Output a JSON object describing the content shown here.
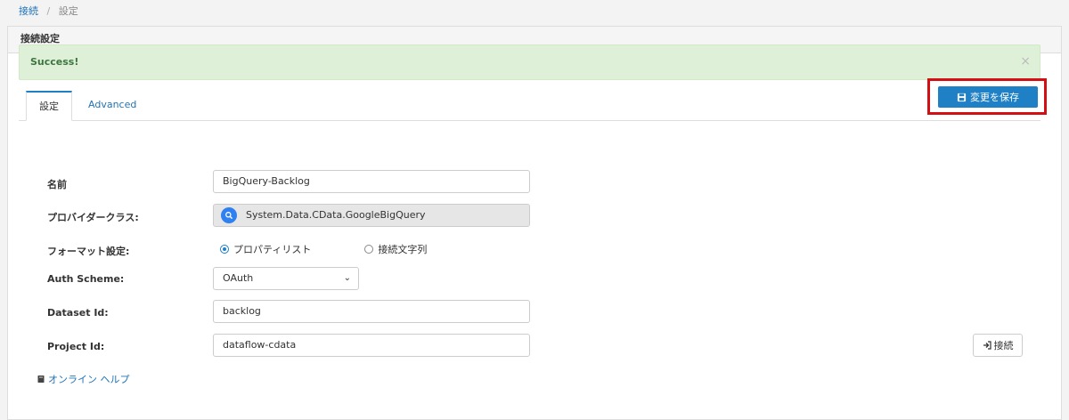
{
  "breadcrumb": {
    "root": "接続",
    "separator": "/",
    "current": "設定"
  },
  "panel": {
    "title": "接続設定"
  },
  "alert": {
    "message": "Success!",
    "close": "×"
  },
  "toolbar": {
    "save_label": "変更を保存"
  },
  "tabs": [
    {
      "label": "設定",
      "active": true
    },
    {
      "label": "Advanced",
      "active": false
    }
  ],
  "form": {
    "name": {
      "label": "名前",
      "value": "BigQuery-Backlog"
    },
    "provider": {
      "label": "プロバイダークラス:",
      "value": "System.Data.CData.GoogleBigQuery"
    },
    "format": {
      "label": "フォーマット設定:",
      "options": [
        "プロパティリスト",
        "接続文字列"
      ],
      "selected": "プロパティリスト"
    },
    "auth_scheme": {
      "label": "Auth Scheme:",
      "value": "OAuth"
    },
    "dataset_id": {
      "label": "Dataset Id:",
      "value": "backlog"
    },
    "project_id": {
      "label": "Project Id:",
      "value": "dataflow-cdata"
    }
  },
  "connect_label": "接続",
  "help_label": "オンライン ヘルプ",
  "colors": {
    "primary": "#1f80c6",
    "success_bg": "#dff0d8",
    "highlight": "#d40f14"
  }
}
